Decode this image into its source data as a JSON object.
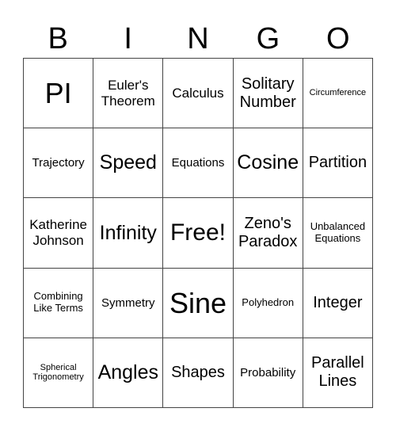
{
  "header": [
    "B",
    "I",
    "N",
    "G",
    "O"
  ],
  "cells": [
    "PI",
    "Euler's Theorem",
    "Calculus",
    "Solitary Number",
    "Circumference",
    "Trajectory",
    "Speed",
    "Equations",
    "Cosine",
    "Partition",
    "Katherine Johnson",
    "Infinity",
    "Free!",
    "Zeno's Paradox",
    "Unbalanced Equations",
    "Combining Like Terms",
    "Symmetry",
    "Sine",
    "Polyhedron",
    "Integer",
    "Spherical Trigonometry",
    "Angles",
    "Shapes",
    "Probability",
    "Parallel Lines"
  ]
}
